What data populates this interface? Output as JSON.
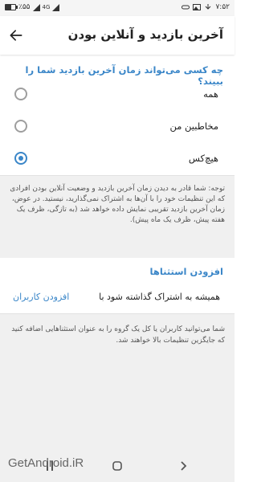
{
  "status_bar": {
    "battery": "٪۵۵",
    "network": "4G",
    "time": "۷:۵۲",
    "battery_level": 0.55
  },
  "app_bar": {
    "title": "آخرین بازدید و آنلاین بودن",
    "back_icon": "arrow-left-icon"
  },
  "visibility": {
    "question": "چه کسی می‌تواند زمان آخرین بازدید شما را ببیند؟",
    "options": [
      {
        "label": "همه",
        "checked": false
      },
      {
        "label": "مخاطبین من",
        "checked": false
      },
      {
        "label": "هیچ‌کس",
        "checked": true
      }
    ]
  },
  "info_text": "توجه: شما قادر به دیدن زمان آخرین بازدید و وضعیت آنلاین بودن افرادی که این تنظیمات خود را با آن‌ها به اشتراک نمی‌گذارید، نیستید. در عوض، زمان آخرین بازدید تقریبی نمایش داده خواهد شد (به تازگی، ظرف یک هفته پیش، ظرف یک ماه پیش).",
  "exceptions": {
    "title": "افزودن استثناها",
    "always_share_label": "همیشه به اشتراک گذاشته شود با",
    "add_users_label": "افزودن کاربران"
  },
  "exceptions_info": "شما می‌توانید کاربران یا کل یک گروه را به عنوان استثناهایی اضافه کنید که جایگزین تنظیمات بالا خواهند شد.",
  "watermark": "GetAndroid.iR",
  "accent_color": "#3a86c8"
}
